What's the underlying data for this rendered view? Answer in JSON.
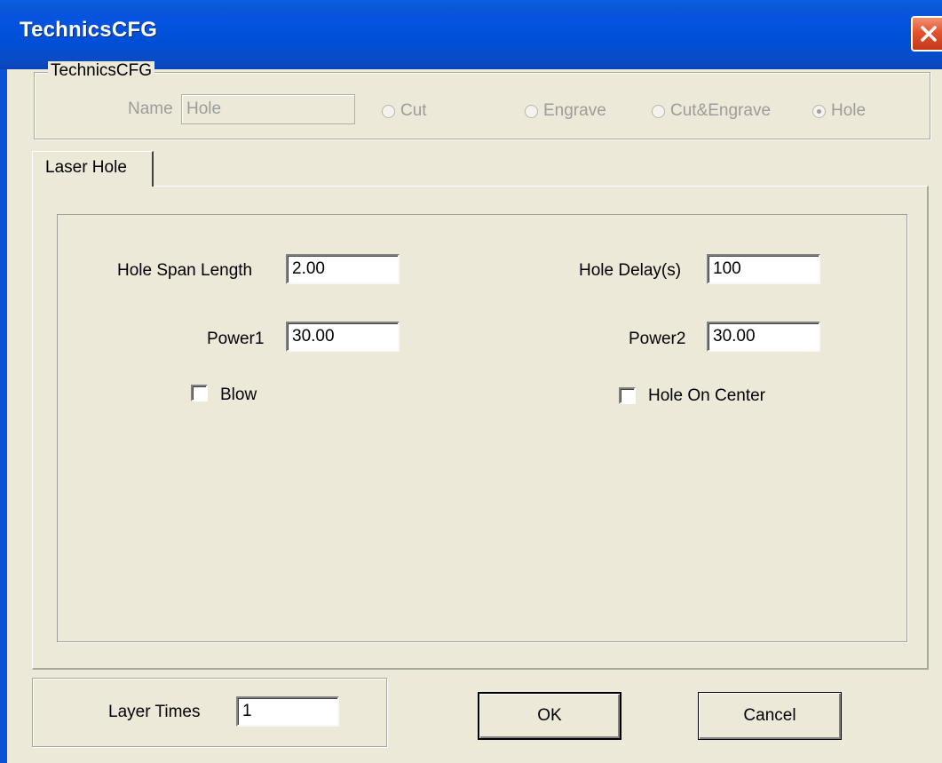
{
  "window": {
    "title": "TechnicsCFG"
  },
  "technics_group": {
    "legend": "TechnicsCFG",
    "name_label": "Name",
    "name_value": "Hole",
    "radio_options": [
      {
        "label": "Cut",
        "selected": false
      },
      {
        "label": "Engrave",
        "selected": false
      },
      {
        "label": "Cut&Engrave",
        "selected": false
      },
      {
        "label": "Hole",
        "selected": true
      }
    ]
  },
  "tabs": [
    {
      "label": "Laser Hole",
      "active": true
    }
  ],
  "laser_hole": {
    "hole_span_length_label": "Hole Span Length",
    "hole_span_length_value": "2.00",
    "hole_delay_label": "Hole Delay(s)",
    "hole_delay_value": "100",
    "power1_label": "Power1",
    "power1_value": "30.00",
    "power2_label": "Power2",
    "power2_value": "30.00",
    "blow_label": "Blow",
    "blow_checked": false,
    "hole_on_center_label": "Hole On Center",
    "hole_on_center_checked": false
  },
  "layer": {
    "label": "Layer Times",
    "value": "1"
  },
  "buttons": {
    "ok": "OK",
    "cancel": "Cancel"
  },
  "colors": {
    "titlebar": "#0553e0",
    "window_bg": "#ece9d8",
    "close": "#e2542e",
    "disabled_text": "#9c9c9c"
  }
}
